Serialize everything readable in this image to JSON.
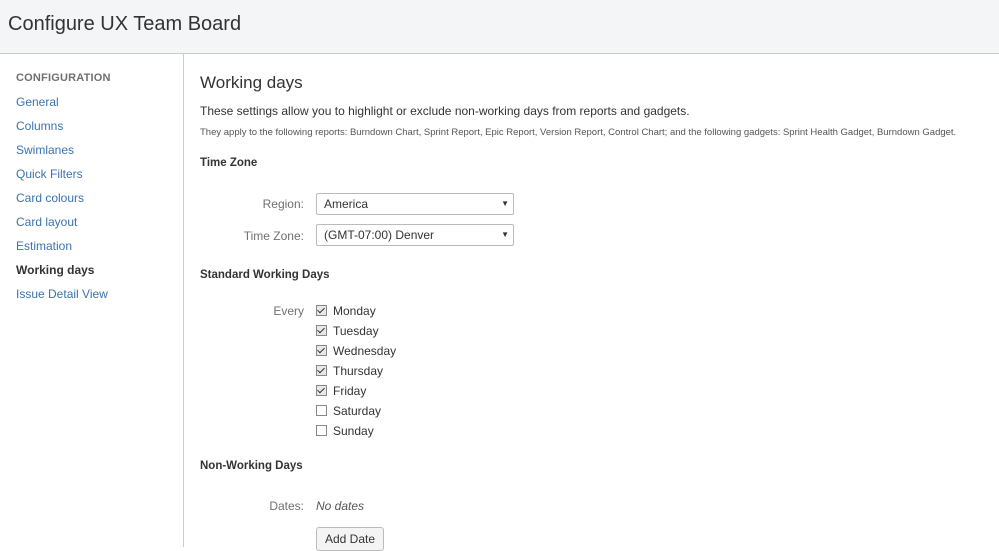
{
  "header": {
    "title": "Configure UX Team Board"
  },
  "sidebar": {
    "heading": "CONFIGURATION",
    "items": [
      {
        "label": "General"
      },
      {
        "label": "Columns"
      },
      {
        "label": "Swimlanes"
      },
      {
        "label": "Quick Filters"
      },
      {
        "label": "Card colours"
      },
      {
        "label": "Card layout"
      },
      {
        "label": "Estimation"
      },
      {
        "label": "Working days",
        "active": true
      },
      {
        "label": "Issue Detail View"
      }
    ]
  },
  "main": {
    "title": "Working days",
    "intro": "These settings allow you to highlight or exclude non-working days from reports and gadgets.",
    "note": "They apply to the following reports: Burndown Chart, Sprint Report, Epic Report, Version Report, Control Chart; and the following gadgets: Sprint Health Gadget, Burndown Gadget.",
    "time_zone": {
      "title": "Time Zone",
      "region_label": "Region:",
      "region_value": "America",
      "tz_label": "Time Zone:",
      "tz_value": "(GMT-07:00) Denver",
      "caret_icon": "▼"
    },
    "working_days": {
      "title": "Standard Working Days",
      "every_label": "Every",
      "days": [
        {
          "label": "Monday",
          "checked": true
        },
        {
          "label": "Tuesday",
          "checked": true
        },
        {
          "label": "Wednesday",
          "checked": true
        },
        {
          "label": "Thursday",
          "checked": true
        },
        {
          "label": "Friday",
          "checked": true
        },
        {
          "label": "Saturday",
          "checked": false
        },
        {
          "label": "Sunday",
          "checked": false
        }
      ]
    },
    "non_working": {
      "title": "Non-Working Days",
      "dates_label": "Dates:",
      "dates_value": "No dates",
      "add_button": "Add Date"
    }
  }
}
